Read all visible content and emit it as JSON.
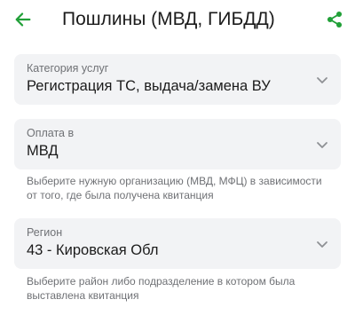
{
  "header": {
    "title": "Пошлины (МВД, ГИБДД)",
    "accent_color": "#21a038",
    "back_icon": "arrow-left-icon",
    "share_icon": "share-icon"
  },
  "form": {
    "category": {
      "label": "Категория услуг",
      "value": "Регистрация ТС, выдача/замена ВУ"
    },
    "payment": {
      "label": "Оплата в",
      "value": "МВД",
      "hint": "Выберите нужную организацию (МВД, МФЦ) в зависимости от того, где была получена квитанция"
    },
    "region": {
      "label": "Регион",
      "value": "43 - Кировская Обл",
      "hint": "Выберите район либо подразделение в котором была выставлена квитанция"
    }
  }
}
